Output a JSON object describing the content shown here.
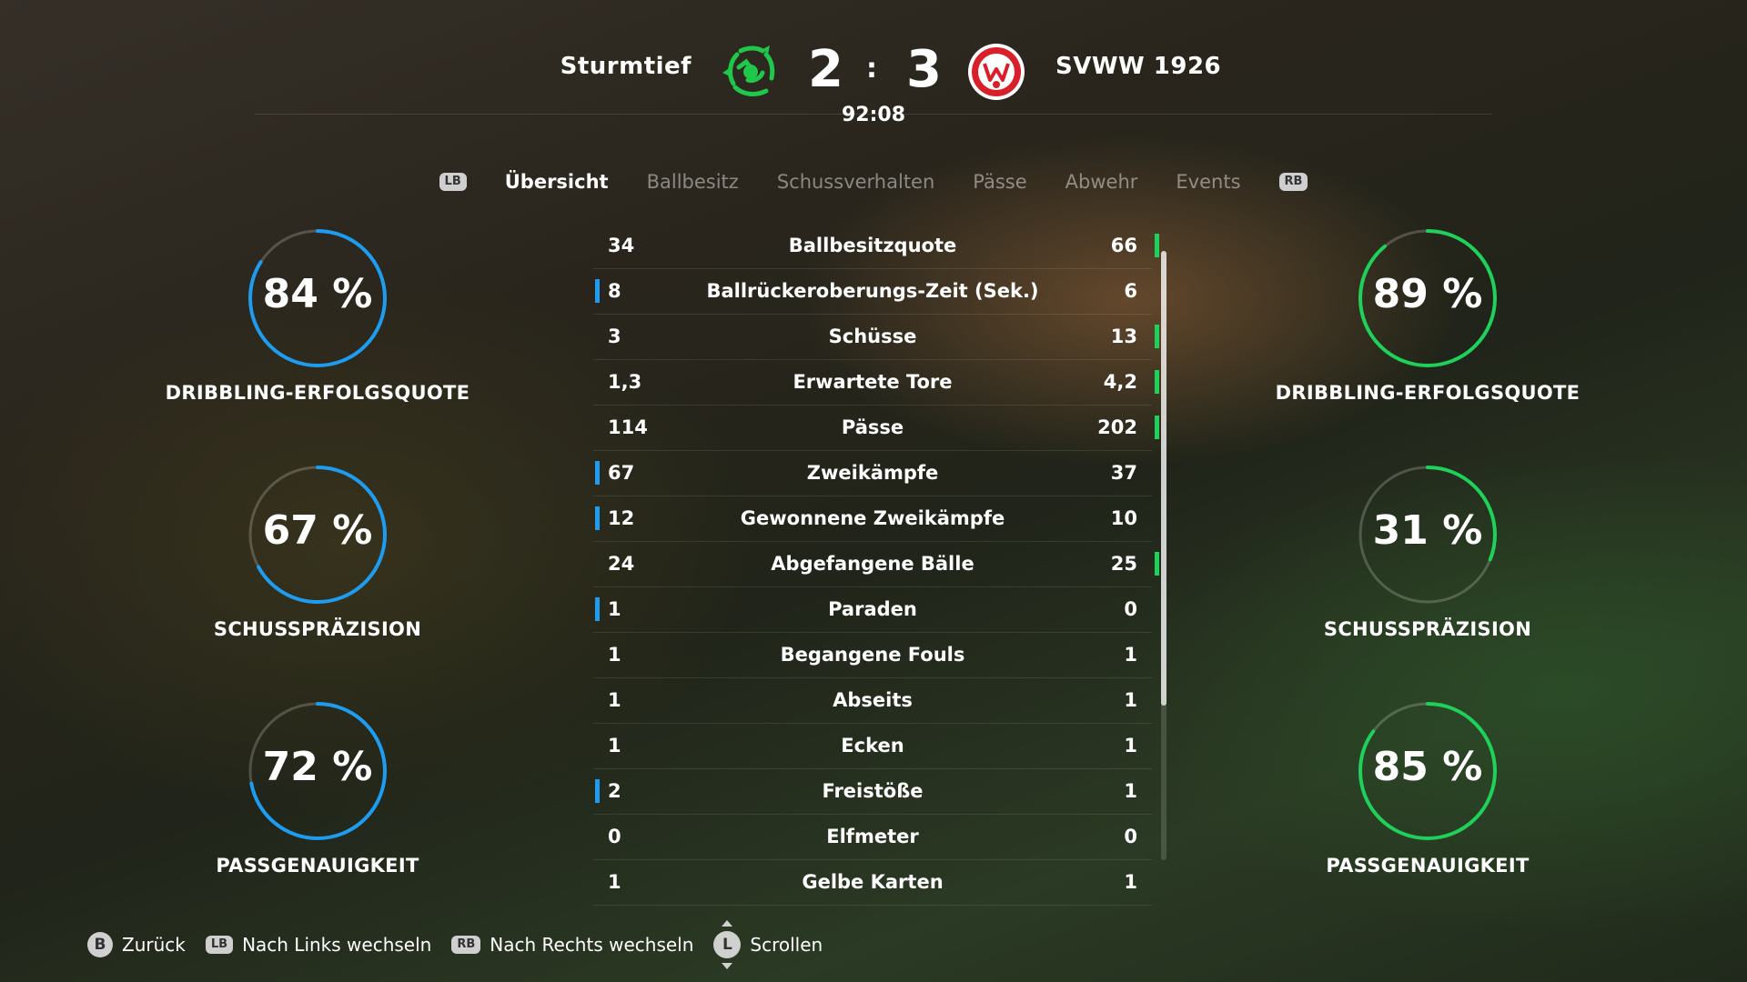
{
  "match": {
    "home_team": "Sturmtief",
    "away_team": "SVWW 1926",
    "home_score": "2",
    "separator": ":",
    "away_score": "3",
    "clock": "92:08"
  },
  "colors": {
    "home": "#1e9cf0",
    "away": "#1fd15a"
  },
  "tabs": {
    "lb": "LB",
    "rb": "RB",
    "items": [
      "Übersicht",
      "Ballbesitz",
      "Schussverhalten",
      "Pässe",
      "Abwehr",
      "Events"
    ],
    "active_index": 0
  },
  "home_rings": [
    {
      "value": 84,
      "text": "84 %",
      "label": "DRIBBLING-ERFOLGSQUOTE"
    },
    {
      "value": 67,
      "text": "67 %",
      "label": "SCHUSSPRÄZISION"
    },
    {
      "value": 72,
      "text": "72 %",
      "label": "PASSGENAUIGKEIT"
    }
  ],
  "away_rings": [
    {
      "value": 89,
      "text": "89 %",
      "label": "DRIBBLING-ERFOLGSQUOTE"
    },
    {
      "value": 31,
      "text": "31 %",
      "label": "SCHUSSPRÄZISION"
    },
    {
      "value": 85,
      "text": "85 %",
      "label": "PASSGENAUIGKEIT"
    }
  ],
  "stats": [
    {
      "home": "34",
      "label": "Ballbesitzquote",
      "away": "66",
      "leader": "away"
    },
    {
      "home": "8",
      "label": "Ballrückeroberungs-Zeit (Sek.)",
      "away": "6",
      "leader": "home"
    },
    {
      "home": "3",
      "label": "Schüsse",
      "away": "13",
      "leader": "away"
    },
    {
      "home": "1,3",
      "label": "Erwartete Tore",
      "away": "4,2",
      "leader": "away"
    },
    {
      "home": "114",
      "label": "Pässe",
      "away": "202",
      "leader": "away"
    },
    {
      "home": "67",
      "label": "Zweikämpfe",
      "away": "37",
      "leader": "home"
    },
    {
      "home": "12",
      "label": "Gewonnene Zweikämpfe",
      "away": "10",
      "leader": "home"
    },
    {
      "home": "24",
      "label": "Abgefangene Bälle",
      "away": "25",
      "leader": "away"
    },
    {
      "home": "1",
      "label": "Paraden",
      "away": "0",
      "leader": "home"
    },
    {
      "home": "1",
      "label": "Begangene Fouls",
      "away": "1",
      "leader": "none"
    },
    {
      "home": "1",
      "label": "Abseits",
      "away": "1",
      "leader": "none"
    },
    {
      "home": "1",
      "label": "Ecken",
      "away": "1",
      "leader": "none"
    },
    {
      "home": "2",
      "label": "Freistöße",
      "away": "1",
      "leader": "home"
    },
    {
      "home": "0",
      "label": "Elfmeter",
      "away": "0",
      "leader": "none"
    },
    {
      "home": "1",
      "label": "Gelbe Karten",
      "away": "1",
      "leader": "none"
    }
  ],
  "footer": {
    "back_key": "B",
    "back": "Zurück",
    "left_key": "LB",
    "left": "Nach Links wechseln",
    "right_key": "RB",
    "right": "Nach Rechts wechseln",
    "scroll_key": "L",
    "scroll": "Scrollen"
  }
}
